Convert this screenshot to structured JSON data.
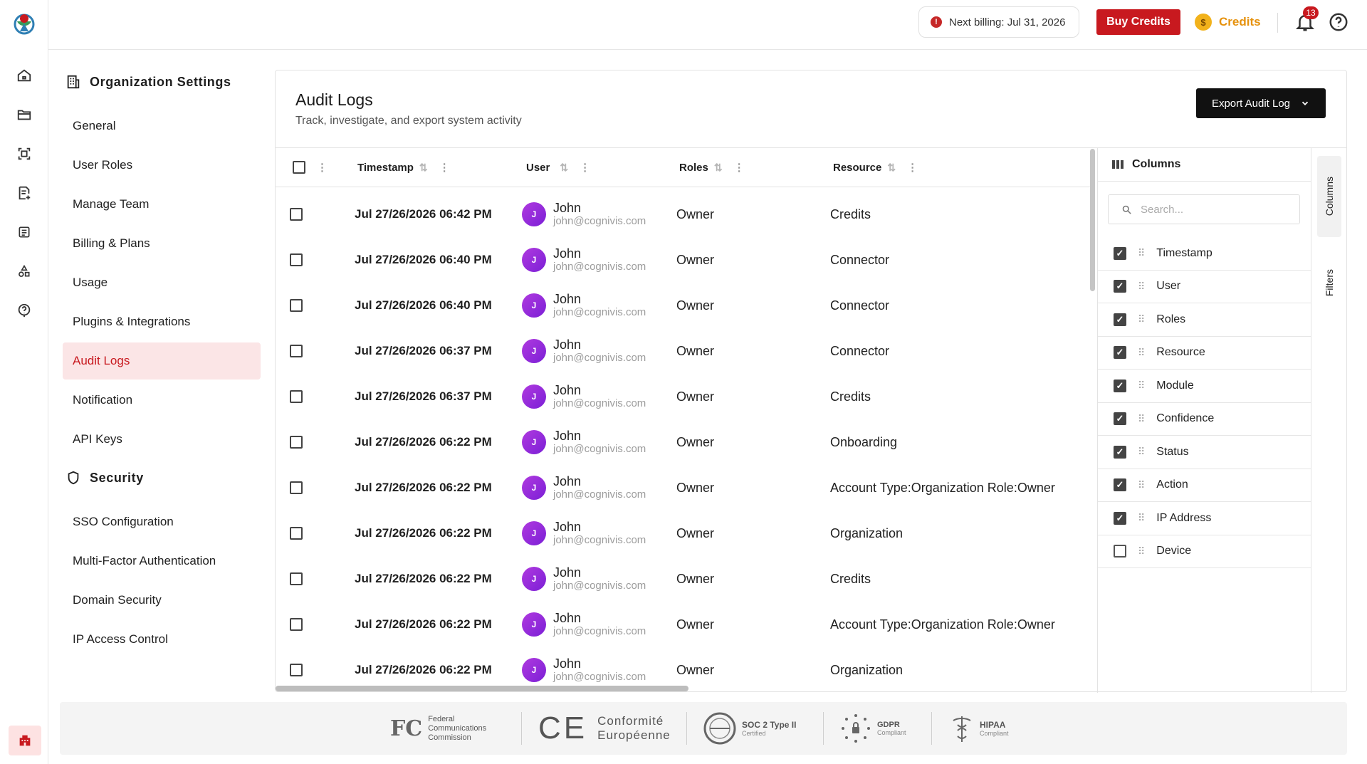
{
  "topbar": {
    "billing_text": "Next billing: Jul 31, 2026",
    "buy_label": "Buy Credits",
    "credits_label": "Credits",
    "notifications_count": "13"
  },
  "settings": {
    "org_heading": "Organization Settings",
    "org_items": [
      {
        "label": "General"
      },
      {
        "label": "User Roles"
      },
      {
        "label": "Manage Team"
      },
      {
        "label": "Billing & Plans"
      },
      {
        "label": "Usage"
      },
      {
        "label": "Plugins & Integrations"
      },
      {
        "label": "Audit Logs"
      },
      {
        "label": "Notification"
      },
      {
        "label": "API Keys"
      }
    ],
    "security_heading": "Security",
    "security_items": [
      {
        "label": "SSO Configuration"
      },
      {
        "label": "Multi-Factor Authentication"
      },
      {
        "label": "Domain Security"
      },
      {
        "label": "IP Access Control"
      }
    ]
  },
  "page": {
    "title": "Audit Logs",
    "subtitle": "Track, investigate, and export system activity",
    "export_label": "Export Audit Log"
  },
  "table": {
    "headers": {
      "timestamp": "Timestamp",
      "user": "User",
      "roles": "Roles",
      "resource": "Resource"
    },
    "rows": [
      {
        "timestamp": "Jul 27/26/2026 06:42 PM",
        "initial": "J",
        "name": "John",
        "email": "john@cognivis.com",
        "role": "Owner",
        "resource": "Credits"
      },
      {
        "timestamp": "Jul 27/26/2026 06:40 PM",
        "initial": "J",
        "name": "John",
        "email": "john@cognivis.com",
        "role": "Owner",
        "resource": "Connector"
      },
      {
        "timestamp": "Jul 27/26/2026 06:40 PM",
        "initial": "J",
        "name": "John",
        "email": "john@cognivis.com",
        "role": "Owner",
        "resource": "Connector"
      },
      {
        "timestamp": "Jul 27/26/2026 06:37 PM",
        "initial": "J",
        "name": "John",
        "email": "john@cognivis.com",
        "role": "Owner",
        "resource": "Connector"
      },
      {
        "timestamp": "Jul 27/26/2026 06:37 PM",
        "initial": "J",
        "name": "John",
        "email": "john@cognivis.com",
        "role": "Owner",
        "resource": "Credits"
      },
      {
        "timestamp": "Jul 27/26/2026 06:22 PM",
        "initial": "J",
        "name": "John",
        "email": "john@cognivis.com",
        "role": "Owner",
        "resource": "Onboarding"
      },
      {
        "timestamp": "Jul 27/26/2026 06:22 PM",
        "initial": "J",
        "name": "John",
        "email": "john@cognivis.com",
        "role": "Owner",
        "resource": "Account Type:Organization Role:Owner"
      },
      {
        "timestamp": "Jul 27/26/2026 06:22 PM",
        "initial": "J",
        "name": "John",
        "email": "john@cognivis.com",
        "role": "Owner",
        "resource": "Organization"
      },
      {
        "timestamp": "Jul 27/26/2026 06:22 PM",
        "initial": "J",
        "name": "John",
        "email": "john@cognivis.com",
        "role": "Owner",
        "resource": "Credits"
      },
      {
        "timestamp": "Jul 27/26/2026 06:22 PM",
        "initial": "J",
        "name": "John",
        "email": "john@cognivis.com",
        "role": "Owner",
        "resource": "Account Type:Organization Role:Owner"
      },
      {
        "timestamp": "Jul 27/26/2026 06:22 PM",
        "initial": "J",
        "name": "John",
        "email": "john@cognivis.com",
        "role": "Owner",
        "resource": "Organization"
      }
    ]
  },
  "columns_panel": {
    "title": "Columns",
    "search_placeholder": "Search...",
    "items": [
      {
        "label": "Timestamp",
        "checked": true
      },
      {
        "label": "User",
        "checked": true
      },
      {
        "label": "Roles",
        "checked": true
      },
      {
        "label": "Resource",
        "checked": true
      },
      {
        "label": "Module",
        "checked": true
      },
      {
        "label": "Confidence",
        "checked": true
      },
      {
        "label": "Status",
        "checked": true
      },
      {
        "label": "Action",
        "checked": true
      },
      {
        "label": "IP Address",
        "checked": true
      },
      {
        "label": "Device",
        "checked": false
      }
    ]
  },
  "side_tabs": {
    "columns": "Columns",
    "filters": "Filters"
  },
  "footer": {
    "fcc": [
      "Federal",
      "Communications",
      "Commission"
    ],
    "ce": [
      "Conformité",
      "Européenne"
    ],
    "soc": {
      "title": "SOC 2 Type II",
      "sub": "Certified"
    },
    "gdpr": {
      "title": "GDPR",
      "sub": "Compliant"
    },
    "hipaa": {
      "title": "HIPAA",
      "sub": "Compliant"
    }
  },
  "colors": {
    "brand_red": "#c8191f",
    "credits_orange": "#e6920e",
    "active_bg": "#fbe5e6"
  }
}
